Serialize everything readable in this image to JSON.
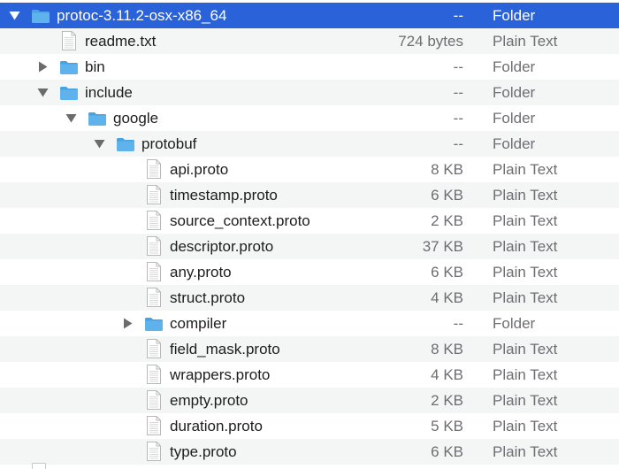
{
  "file_list": {
    "rows": [
      {
        "name": "protoc-3.11.2-osx-x86_64",
        "size": "--",
        "kind": "Folder",
        "type": "folder",
        "disclosure": "expanded",
        "depth": 0,
        "selected": true
      },
      {
        "name": "readme.txt",
        "size": "724 bytes",
        "kind": "Plain Text",
        "type": "file",
        "disclosure": "none",
        "depth": 1
      },
      {
        "name": "bin",
        "size": "--",
        "kind": "Folder",
        "type": "folder",
        "disclosure": "collapsed",
        "depth": 1
      },
      {
        "name": "include",
        "size": "--",
        "kind": "Folder",
        "type": "folder",
        "disclosure": "expanded",
        "depth": 1
      },
      {
        "name": "google",
        "size": "--",
        "kind": "Folder",
        "type": "folder",
        "disclosure": "expanded",
        "depth": 2
      },
      {
        "name": "protobuf",
        "size": "--",
        "kind": "Folder",
        "type": "folder",
        "disclosure": "expanded",
        "depth": 3
      },
      {
        "name": "api.proto",
        "size": "8 KB",
        "kind": "Plain Text",
        "type": "file",
        "disclosure": "none",
        "depth": 4
      },
      {
        "name": "timestamp.proto",
        "size": "6 KB",
        "kind": "Plain Text",
        "type": "file",
        "disclosure": "none",
        "depth": 4
      },
      {
        "name": "source_context.proto",
        "size": "2 KB",
        "kind": "Plain Text",
        "type": "file",
        "disclosure": "none",
        "depth": 4
      },
      {
        "name": "descriptor.proto",
        "size": "37 KB",
        "kind": "Plain Text",
        "type": "file",
        "disclosure": "none",
        "depth": 4
      },
      {
        "name": "any.proto",
        "size": "6 KB",
        "kind": "Plain Text",
        "type": "file",
        "disclosure": "none",
        "depth": 4
      },
      {
        "name": "struct.proto",
        "size": "4 KB",
        "kind": "Plain Text",
        "type": "file",
        "disclosure": "none",
        "depth": 4
      },
      {
        "name": "compiler",
        "size": "--",
        "kind": "Folder",
        "type": "folder",
        "disclosure": "collapsed",
        "depth": 4
      },
      {
        "name": "field_mask.proto",
        "size": "8 KB",
        "kind": "Plain Text",
        "type": "file",
        "disclosure": "none",
        "depth": 4
      },
      {
        "name": "wrappers.proto",
        "size": "4 KB",
        "kind": "Plain Text",
        "type": "file",
        "disclosure": "none",
        "depth": 4
      },
      {
        "name": "empty.proto",
        "size": "2 KB",
        "kind": "Plain Text",
        "type": "file",
        "disclosure": "none",
        "depth": 4
      },
      {
        "name": "duration.proto",
        "size": "5 KB",
        "kind": "Plain Text",
        "type": "file",
        "disclosure": "none",
        "depth": 4
      },
      {
        "name": "type.proto",
        "size": "6 KB",
        "kind": "Plain Text",
        "type": "file",
        "disclosure": "none",
        "depth": 4
      }
    ]
  },
  "icons": {
    "folder": "folder-icon",
    "file": "document-icon",
    "expanded": "disclosure-triangle-down-icon",
    "collapsed": "disclosure-triangle-right-icon"
  },
  "colors": {
    "selection": "#2a62d9",
    "folder_fill": "#5fb3ec",
    "folder_tab": "#4aa2df",
    "alt_row": "#f4f5f5",
    "secondary_text": "#6e6e73"
  }
}
